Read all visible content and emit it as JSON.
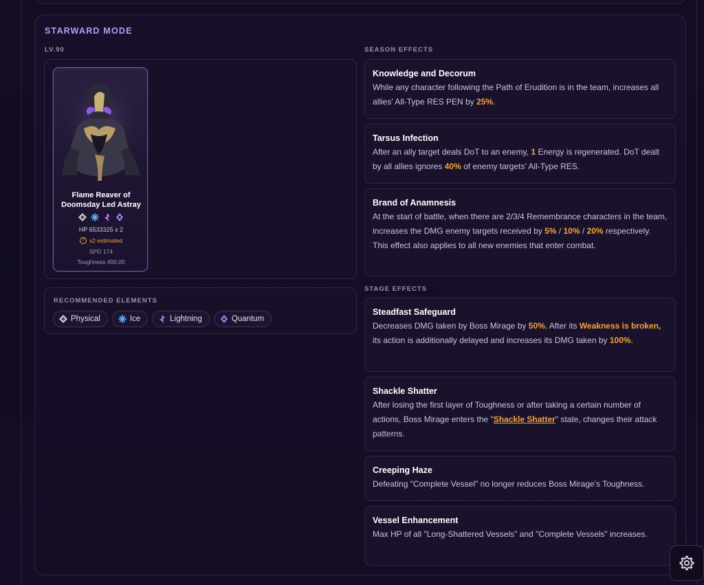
{
  "mode": {
    "title": "STARWARD MODE"
  },
  "enemy": {
    "level_label": "LV.90",
    "name": "Flame Reaver of Doomsday Led Astray",
    "weaknesses": [
      "physical-icon",
      "ice-icon",
      "lightning-icon",
      "quantum-icon"
    ],
    "hp": "HP 6533325 x 2",
    "estimate": "x2 estimated",
    "spd": "SPD 174",
    "toughness": "Toughness 400.00",
    "border_color": "#8a4fb8"
  },
  "recommended": {
    "label": "RECOMMENDED ELEMENTS",
    "elements": [
      {
        "name": "Physical",
        "icon": "physical-icon",
        "color": "#cfcfd6"
      },
      {
        "name": "Ice",
        "icon": "ice-icon",
        "color": "#5fb4ff"
      },
      {
        "name": "Lightning",
        "icon": "lightning-icon",
        "color": "#c27be8"
      },
      {
        "name": "Quantum",
        "icon": "quantum-icon",
        "color": "#9a86f0"
      }
    ]
  },
  "season": {
    "label": "SEASON EFFECTS",
    "effects": [
      {
        "title": "Knowledge and Decorum",
        "desc": [
          {
            "t": "While any character following the Path of Erudition is in the team, increases all allies' All-Type RES PEN by "
          },
          {
            "t": "25%",
            "hl": true
          },
          {
            "t": "."
          }
        ]
      },
      {
        "title": "Tarsus Infection",
        "desc": [
          {
            "t": "After an ally target deals DoT to an enemy, "
          },
          {
            "t": "1",
            "hl": true
          },
          {
            "t": " Energy is regenerated. DoT dealt by all allies ignores "
          },
          {
            "t": "40%",
            "hl": true
          },
          {
            "t": " of enemy targets' All-Type RES."
          }
        ]
      },
      {
        "title": "Brand of Anamnesis",
        "desc": [
          {
            "t": "At the start of battle, when there are 2/3/4 Remembrance characters in the team, increases the DMG enemy targets received by "
          },
          {
            "t": "5%",
            "hl": true
          },
          {
            "t": " / "
          },
          {
            "t": "10%",
            "hl": true
          },
          {
            "t": " / "
          },
          {
            "t": "20%",
            "hl": true
          },
          {
            "t": " respectively. This effect also applies to all new enemies that enter combat."
          }
        ]
      }
    ]
  },
  "stage": {
    "label": "STAGE EFFECTS",
    "effects": [
      {
        "title": "Steadfast Safeguard",
        "desc": [
          {
            "t": "Decreases DMG taken by Boss Mirage by "
          },
          {
            "t": "50%",
            "hl": true
          },
          {
            "t": ". After its "
          },
          {
            "t": "Weakness is broken,",
            "hl": true
          },
          {
            "t": " its action is additionally delayed and increases its DMG taken by "
          },
          {
            "t": "100%",
            "hl": true
          },
          {
            "t": "."
          }
        ]
      },
      {
        "title": "Shackle Shatter",
        "desc": [
          {
            "t": "After losing the first layer of Toughness or after taking a certain number of actions, Boss Mirage enters the \""
          },
          {
            "t": "Shackle Shatter",
            "link": true
          },
          {
            "t": "\" state, changes their attack patterns."
          }
        ]
      },
      {
        "title": "Creeping Haze",
        "desc": [
          {
            "t": "Defeating \"Complete Vessel\" no longer reduces Boss Mirage's Toughness."
          }
        ]
      },
      {
        "title": "Vessel Enhancement",
        "desc": [
          {
            "t": "Max HP of all \"Long-Shattered Vessels\" and \"Complete Vessels\" increases."
          }
        ]
      }
    ]
  },
  "colors": {
    "accent": "#b99cf2",
    "highlight": "#f4a43c"
  }
}
